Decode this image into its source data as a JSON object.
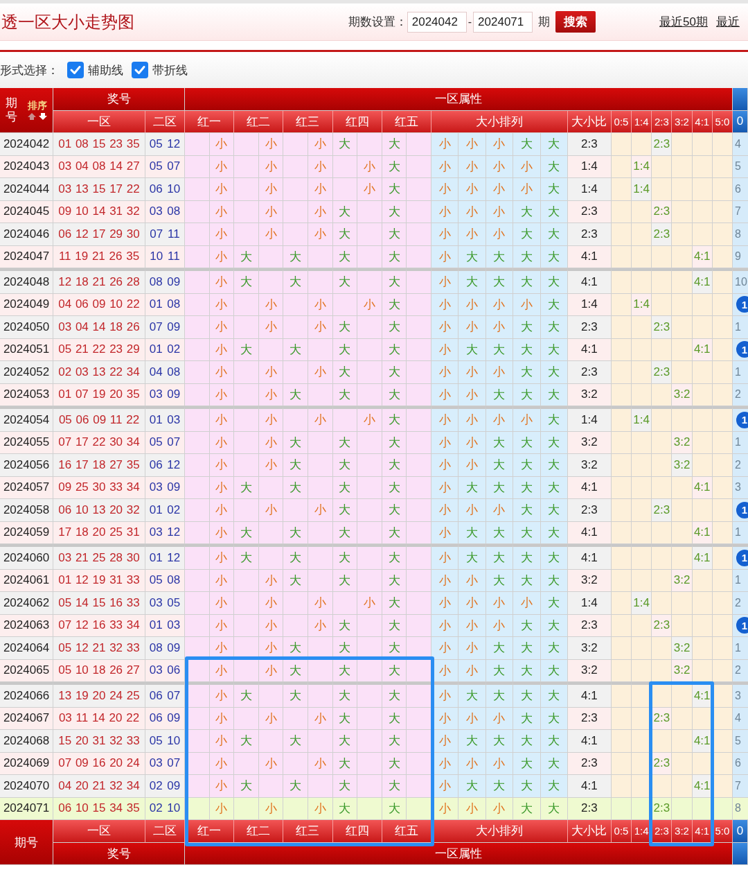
{
  "title": "透一区大小走势图",
  "period_setting": {
    "label": "期数设置：",
    "from": "2024042",
    "separator": "-",
    "to": "2024071",
    "unit": "期",
    "button": "搜索"
  },
  "links": [
    "最近50期",
    "最近"
  ],
  "form": {
    "label": "形式选择：",
    "options": [
      {
        "label": "辅助线",
        "checked": true
      },
      {
        "label": "带折线",
        "checked": true
      }
    ]
  },
  "table_header": {
    "period": "期号",
    "sort": "排序",
    "group_prize": "奖号",
    "group_attr": "一区属性",
    "zone1": "一区",
    "zone2": "二区",
    "positions": [
      "红一",
      "红二",
      "红三",
      "红四",
      "红五"
    ],
    "sequence": "大小排列",
    "ratio": "大小比",
    "distribution": [
      "0:5",
      "1:4",
      "2:3",
      "3:2",
      "4:1",
      "5:0"
    ],
    "extra": "0"
  },
  "rows": [
    {
      "period": "2024042",
      "zone1": "01 08 15 23 35",
      "zone2": "05 12",
      "highlighted": false,
      "positions": [
        {
          "text": "小",
          "big": false
        },
        {
          "text": "小",
          "big": false
        },
        {
          "text": "小",
          "big": false
        },
        {
          "text": "大",
          "big": true
        },
        {
          "text": "大",
          "big": true
        }
      ],
      "sequence": [
        {
          "text": "小",
          "big": false
        },
        {
          "text": "小",
          "big": false
        },
        {
          "text": "小",
          "big": false
        },
        {
          "text": "大",
          "big": true
        },
        {
          "text": "大",
          "big": true
        }
      ],
      "ratio": "2:3",
      "distribution": [
        false,
        false,
        true,
        false,
        false,
        false
      ],
      "ratio_mark": "2:3",
      "extra": {
        "text": "4",
        "circled": false
      }
    },
    {
      "period": "2024043",
      "zone1": "03 04 08 14 27",
      "zone2": "05 07",
      "highlighted": false,
      "positions": [
        {
          "text": "小",
          "big": false
        },
        {
          "text": "小",
          "big": false
        },
        {
          "text": "小",
          "big": false
        },
        {
          "text": "小",
          "big": false
        },
        {
          "text": "大",
          "big": true
        }
      ],
      "sequence": [
        {
          "text": "小",
          "big": false
        },
        {
          "text": "小",
          "big": false
        },
        {
          "text": "小",
          "big": false
        },
        {
          "text": "小",
          "big": false
        },
        {
          "text": "大",
          "big": true
        }
      ],
      "ratio": "1:4",
      "distribution": [
        false,
        true,
        false,
        false,
        false,
        false
      ],
      "ratio_mark": "1:4",
      "extra": {
        "text": "5",
        "circled": false
      }
    },
    {
      "period": "2024044",
      "zone1": "03 13 15 17 22",
      "zone2": "06 10",
      "highlighted": false,
      "positions": [
        {
          "text": "小",
          "big": false
        },
        {
          "text": "小",
          "big": false
        },
        {
          "text": "小",
          "big": false
        },
        {
          "text": "小",
          "big": false
        },
        {
          "text": "大",
          "big": true
        }
      ],
      "sequence": [
        {
          "text": "小",
          "big": false
        },
        {
          "text": "小",
          "big": false
        },
        {
          "text": "小",
          "big": false
        },
        {
          "text": "小",
          "big": false
        },
        {
          "text": "大",
          "big": true
        }
      ],
      "ratio": "1:4",
      "distribution": [
        false,
        true,
        false,
        false,
        false,
        false
      ],
      "ratio_mark": "1:4",
      "extra": {
        "text": "6",
        "circled": false
      }
    },
    {
      "period": "2024045",
      "zone1": "09 10 14 31 32",
      "zone2": "03 08",
      "highlighted": false,
      "positions": [
        {
          "text": "小",
          "big": false
        },
        {
          "text": "小",
          "big": false
        },
        {
          "text": "小",
          "big": false
        },
        {
          "text": "大",
          "big": true
        },
        {
          "text": "大",
          "big": true
        }
      ],
      "sequence": [
        {
          "text": "小",
          "big": false
        },
        {
          "text": "小",
          "big": false
        },
        {
          "text": "小",
          "big": false
        },
        {
          "text": "大",
          "big": true
        },
        {
          "text": "大",
          "big": true
        }
      ],
      "ratio": "2:3",
      "distribution": [
        false,
        false,
        true,
        false,
        false,
        false
      ],
      "ratio_mark": "2:3",
      "extra": {
        "text": "7",
        "circled": false
      }
    },
    {
      "period": "2024046",
      "zone1": "06 12 17 29 30",
      "zone2": "07 11",
      "highlighted": false,
      "positions": [
        {
          "text": "小",
          "big": false
        },
        {
          "text": "小",
          "big": false
        },
        {
          "text": "小",
          "big": false
        },
        {
          "text": "大",
          "big": true
        },
        {
          "text": "大",
          "big": true
        }
      ],
      "sequence": [
        {
          "text": "小",
          "big": false
        },
        {
          "text": "小",
          "big": false
        },
        {
          "text": "小",
          "big": false
        },
        {
          "text": "大",
          "big": true
        },
        {
          "text": "大",
          "big": true
        }
      ],
      "ratio": "2:3",
      "distribution": [
        false,
        false,
        true,
        false,
        false,
        false
      ],
      "ratio_mark": "2:3",
      "extra": {
        "text": "8",
        "circled": false
      }
    },
    {
      "period": "2024047",
      "zone1": "11 19 21 26 35",
      "zone2": "10 11",
      "highlighted": false,
      "positions": [
        {
          "text": "小",
          "big": false
        },
        {
          "text": "大",
          "big": true
        },
        {
          "text": "大",
          "big": true
        },
        {
          "text": "大",
          "big": true
        },
        {
          "text": "大",
          "big": true
        }
      ],
      "sequence": [
        {
          "text": "小",
          "big": false
        },
        {
          "text": "大",
          "big": true
        },
        {
          "text": "大",
          "big": true
        },
        {
          "text": "大",
          "big": true
        },
        {
          "text": "大",
          "big": true
        }
      ],
      "ratio": "4:1",
      "distribution": [
        false,
        false,
        false,
        false,
        true,
        false
      ],
      "ratio_mark": "4:1",
      "extra": {
        "text": "9",
        "circled": false
      }
    },
    {
      "period": "2024048",
      "zone1": "12 18 21 26 28",
      "zone2": "08 09",
      "highlighted": false,
      "positions": [
        {
          "text": "小",
          "big": false
        },
        {
          "text": "大",
          "big": true
        },
        {
          "text": "大",
          "big": true
        },
        {
          "text": "大",
          "big": true
        },
        {
          "text": "大",
          "big": true
        }
      ],
      "sequence": [
        {
          "text": "小",
          "big": false
        },
        {
          "text": "大",
          "big": true
        },
        {
          "text": "大",
          "big": true
        },
        {
          "text": "大",
          "big": true
        },
        {
          "text": "大",
          "big": true
        }
      ],
      "ratio": "4:1",
      "distribution": [
        false,
        false,
        false,
        false,
        true,
        false
      ],
      "ratio_mark": "4:1",
      "extra": {
        "text": "10",
        "circled": false
      }
    },
    {
      "period": "2024049",
      "zone1": "04 06 09 10 22",
      "zone2": "01 08",
      "highlighted": false,
      "positions": [
        {
          "text": "小",
          "big": false
        },
        {
          "text": "小",
          "big": false
        },
        {
          "text": "小",
          "big": false
        },
        {
          "text": "小",
          "big": false
        },
        {
          "text": "大",
          "big": true
        }
      ],
      "sequence": [
        {
          "text": "小",
          "big": false
        },
        {
          "text": "小",
          "big": false
        },
        {
          "text": "小",
          "big": false
        },
        {
          "text": "小",
          "big": false
        },
        {
          "text": "大",
          "big": true
        }
      ],
      "ratio": "1:4",
      "distribution": [
        false,
        true,
        false,
        false,
        false,
        false
      ],
      "ratio_mark": "1:4",
      "extra": {
        "text": "1",
        "circled": true
      }
    },
    {
      "period": "2024050",
      "zone1": "03 04 14 18 26",
      "zone2": "07 09",
      "highlighted": false,
      "positions": [
        {
          "text": "小",
          "big": false
        },
        {
          "text": "小",
          "big": false
        },
        {
          "text": "小",
          "big": false
        },
        {
          "text": "大",
          "big": true
        },
        {
          "text": "大",
          "big": true
        }
      ],
      "sequence": [
        {
          "text": "小",
          "big": false
        },
        {
          "text": "小",
          "big": false
        },
        {
          "text": "小",
          "big": false
        },
        {
          "text": "大",
          "big": true
        },
        {
          "text": "大",
          "big": true
        }
      ],
      "ratio": "2:3",
      "distribution": [
        false,
        false,
        true,
        false,
        false,
        false
      ],
      "ratio_mark": "2:3",
      "extra": {
        "text": "1",
        "circled": false
      }
    },
    {
      "period": "2024051",
      "zone1": "05 21 22 23 29",
      "zone2": "01 02",
      "highlighted": false,
      "positions": [
        {
          "text": "小",
          "big": false
        },
        {
          "text": "大",
          "big": true
        },
        {
          "text": "大",
          "big": true
        },
        {
          "text": "大",
          "big": true
        },
        {
          "text": "大",
          "big": true
        }
      ],
      "sequence": [
        {
          "text": "小",
          "big": false
        },
        {
          "text": "大",
          "big": true
        },
        {
          "text": "大",
          "big": true
        },
        {
          "text": "大",
          "big": true
        },
        {
          "text": "大",
          "big": true
        }
      ],
      "ratio": "4:1",
      "distribution": [
        false,
        false,
        false,
        false,
        true,
        false
      ],
      "ratio_mark": "4:1",
      "extra": {
        "text": "1",
        "circled": true
      }
    },
    {
      "period": "2024052",
      "zone1": "02 03 13 22 34",
      "zone2": "04 08",
      "highlighted": false,
      "positions": [
        {
          "text": "小",
          "big": false
        },
        {
          "text": "小",
          "big": false
        },
        {
          "text": "小",
          "big": false
        },
        {
          "text": "大",
          "big": true
        },
        {
          "text": "大",
          "big": true
        }
      ],
      "sequence": [
        {
          "text": "小",
          "big": false
        },
        {
          "text": "小",
          "big": false
        },
        {
          "text": "小",
          "big": false
        },
        {
          "text": "大",
          "big": true
        },
        {
          "text": "大",
          "big": true
        }
      ],
      "ratio": "2:3",
      "distribution": [
        false,
        false,
        true,
        false,
        false,
        false
      ],
      "ratio_mark": "2:3",
      "extra": {
        "text": "1",
        "circled": false
      }
    },
    {
      "period": "2024053",
      "zone1": "01 07 19 20 35",
      "zone2": "03 09",
      "highlighted": false,
      "positions": [
        {
          "text": "小",
          "big": false
        },
        {
          "text": "小",
          "big": false
        },
        {
          "text": "大",
          "big": true
        },
        {
          "text": "大",
          "big": true
        },
        {
          "text": "大",
          "big": true
        }
      ],
      "sequence": [
        {
          "text": "小",
          "big": false
        },
        {
          "text": "小",
          "big": false
        },
        {
          "text": "大",
          "big": true
        },
        {
          "text": "大",
          "big": true
        },
        {
          "text": "大",
          "big": true
        }
      ],
      "ratio": "3:2",
      "distribution": [
        false,
        false,
        false,
        true,
        false,
        false
      ],
      "ratio_mark": "3:2",
      "extra": {
        "text": "2",
        "circled": false
      }
    },
    {
      "period": "2024054",
      "zone1": "05 06 09 11 22",
      "zone2": "01 03",
      "highlighted": false,
      "positions": [
        {
          "text": "小",
          "big": false
        },
        {
          "text": "小",
          "big": false
        },
        {
          "text": "小",
          "big": false
        },
        {
          "text": "小",
          "big": false
        },
        {
          "text": "大",
          "big": true
        }
      ],
      "sequence": [
        {
          "text": "小",
          "big": false
        },
        {
          "text": "小",
          "big": false
        },
        {
          "text": "小",
          "big": false
        },
        {
          "text": "小",
          "big": false
        },
        {
          "text": "大",
          "big": true
        }
      ],
      "ratio": "1:4",
      "distribution": [
        false,
        true,
        false,
        false,
        false,
        false
      ],
      "ratio_mark": "1:4",
      "extra": {
        "text": "1",
        "circled": true
      }
    },
    {
      "period": "2024055",
      "zone1": "07 17 22 30 34",
      "zone2": "05 07",
      "highlighted": false,
      "positions": [
        {
          "text": "小",
          "big": false
        },
        {
          "text": "小",
          "big": false
        },
        {
          "text": "大",
          "big": true
        },
        {
          "text": "大",
          "big": true
        },
        {
          "text": "大",
          "big": true
        }
      ],
      "sequence": [
        {
          "text": "小",
          "big": false
        },
        {
          "text": "小",
          "big": false
        },
        {
          "text": "大",
          "big": true
        },
        {
          "text": "大",
          "big": true
        },
        {
          "text": "大",
          "big": true
        }
      ],
      "ratio": "3:2",
      "distribution": [
        false,
        false,
        false,
        true,
        false,
        false
      ],
      "ratio_mark": "3:2",
      "extra": {
        "text": "1",
        "circled": false
      }
    },
    {
      "period": "2024056",
      "zone1": "16 17 18 27 35",
      "zone2": "06 12",
      "highlighted": false,
      "positions": [
        {
          "text": "小",
          "big": false
        },
        {
          "text": "小",
          "big": false
        },
        {
          "text": "大",
          "big": true
        },
        {
          "text": "大",
          "big": true
        },
        {
          "text": "大",
          "big": true
        }
      ],
      "sequence": [
        {
          "text": "小",
          "big": false
        },
        {
          "text": "小",
          "big": false
        },
        {
          "text": "大",
          "big": true
        },
        {
          "text": "大",
          "big": true
        },
        {
          "text": "大",
          "big": true
        }
      ],
      "ratio": "3:2",
      "distribution": [
        false,
        false,
        false,
        true,
        false,
        false
      ],
      "ratio_mark": "3:2",
      "extra": {
        "text": "2",
        "circled": false
      }
    },
    {
      "period": "2024057",
      "zone1": "09 25 30 33 34",
      "zone2": "03 09",
      "highlighted": false,
      "positions": [
        {
          "text": "小",
          "big": false
        },
        {
          "text": "大",
          "big": true
        },
        {
          "text": "大",
          "big": true
        },
        {
          "text": "大",
          "big": true
        },
        {
          "text": "大",
          "big": true
        }
      ],
      "sequence": [
        {
          "text": "小",
          "big": false
        },
        {
          "text": "大",
          "big": true
        },
        {
          "text": "大",
          "big": true
        },
        {
          "text": "大",
          "big": true
        },
        {
          "text": "大",
          "big": true
        }
      ],
      "ratio": "4:1",
      "distribution": [
        false,
        false,
        false,
        false,
        true,
        false
      ],
      "ratio_mark": "4:1",
      "extra": {
        "text": "3",
        "circled": false
      }
    },
    {
      "period": "2024058",
      "zone1": "06 10 13 20 32",
      "zone2": "01 02",
      "highlighted": false,
      "positions": [
        {
          "text": "小",
          "big": false
        },
        {
          "text": "小",
          "big": false
        },
        {
          "text": "小",
          "big": false
        },
        {
          "text": "大",
          "big": true
        },
        {
          "text": "大",
          "big": true
        }
      ],
      "sequence": [
        {
          "text": "小",
          "big": false
        },
        {
          "text": "小",
          "big": false
        },
        {
          "text": "小",
          "big": false
        },
        {
          "text": "大",
          "big": true
        },
        {
          "text": "大",
          "big": true
        }
      ],
      "ratio": "2:3",
      "distribution": [
        false,
        false,
        true,
        false,
        false,
        false
      ],
      "ratio_mark": "2:3",
      "extra": {
        "text": "1",
        "circled": true
      }
    },
    {
      "period": "2024059",
      "zone1": "17 18 20 25 31",
      "zone2": "03 12",
      "highlighted": false,
      "positions": [
        {
          "text": "小",
          "big": false
        },
        {
          "text": "大",
          "big": true
        },
        {
          "text": "大",
          "big": true
        },
        {
          "text": "大",
          "big": true
        },
        {
          "text": "大",
          "big": true
        }
      ],
      "sequence": [
        {
          "text": "小",
          "big": false
        },
        {
          "text": "大",
          "big": true
        },
        {
          "text": "大",
          "big": true
        },
        {
          "text": "大",
          "big": true
        },
        {
          "text": "大",
          "big": true
        }
      ],
      "ratio": "4:1",
      "distribution": [
        false,
        false,
        false,
        false,
        true,
        false
      ],
      "ratio_mark": "4:1",
      "extra": {
        "text": "1",
        "circled": false
      }
    },
    {
      "period": "2024060",
      "zone1": "03 21 25 28 30",
      "zone2": "01 12",
      "highlighted": false,
      "positions": [
        {
          "text": "小",
          "big": false
        },
        {
          "text": "大",
          "big": true
        },
        {
          "text": "大",
          "big": true
        },
        {
          "text": "大",
          "big": true
        },
        {
          "text": "大",
          "big": true
        }
      ],
      "sequence": [
        {
          "text": "小",
          "big": false
        },
        {
          "text": "大",
          "big": true
        },
        {
          "text": "大",
          "big": true
        },
        {
          "text": "大",
          "big": true
        },
        {
          "text": "大",
          "big": true
        }
      ],
      "ratio": "4:1",
      "distribution": [
        false,
        false,
        false,
        false,
        true,
        false
      ],
      "ratio_mark": "4:1",
      "extra": {
        "text": "1",
        "circled": true
      }
    },
    {
      "period": "2024061",
      "zone1": "01 12 19 31 33",
      "zone2": "05 08",
      "highlighted": false,
      "positions": [
        {
          "text": "小",
          "big": false
        },
        {
          "text": "小",
          "big": false
        },
        {
          "text": "大",
          "big": true
        },
        {
          "text": "大",
          "big": true
        },
        {
          "text": "大",
          "big": true
        }
      ],
      "sequence": [
        {
          "text": "小",
          "big": false
        },
        {
          "text": "小",
          "big": false
        },
        {
          "text": "大",
          "big": true
        },
        {
          "text": "大",
          "big": true
        },
        {
          "text": "大",
          "big": true
        }
      ],
      "ratio": "3:2",
      "distribution": [
        false,
        false,
        false,
        true,
        false,
        false
      ],
      "ratio_mark": "3:2",
      "extra": {
        "text": "1",
        "circled": false
      }
    },
    {
      "period": "2024062",
      "zone1": "05 14 15 16 33",
      "zone2": "03 05",
      "highlighted": false,
      "positions": [
        {
          "text": "小",
          "big": false
        },
        {
          "text": "小",
          "big": false
        },
        {
          "text": "小",
          "big": false
        },
        {
          "text": "小",
          "big": false
        },
        {
          "text": "大",
          "big": true
        }
      ],
      "sequence": [
        {
          "text": "小",
          "big": false
        },
        {
          "text": "小",
          "big": false
        },
        {
          "text": "小",
          "big": false
        },
        {
          "text": "小",
          "big": false
        },
        {
          "text": "大",
          "big": true
        }
      ],
      "ratio": "1:4",
      "distribution": [
        false,
        true,
        false,
        false,
        false,
        false
      ],
      "ratio_mark": "1:4",
      "extra": {
        "text": "2",
        "circled": false
      }
    },
    {
      "period": "2024063",
      "zone1": "07 12 16 33 34",
      "zone2": "01 03",
      "highlighted": false,
      "positions": [
        {
          "text": "小",
          "big": false
        },
        {
          "text": "小",
          "big": false
        },
        {
          "text": "小",
          "big": false
        },
        {
          "text": "大",
          "big": true
        },
        {
          "text": "大",
          "big": true
        }
      ],
      "sequence": [
        {
          "text": "小",
          "big": false
        },
        {
          "text": "小",
          "big": false
        },
        {
          "text": "小",
          "big": false
        },
        {
          "text": "大",
          "big": true
        },
        {
          "text": "大",
          "big": true
        }
      ],
      "ratio": "2:3",
      "distribution": [
        false,
        false,
        true,
        false,
        false,
        false
      ],
      "ratio_mark": "2:3",
      "extra": {
        "text": "1",
        "circled": true
      }
    },
    {
      "period": "2024064",
      "zone1": "05 12 21 32 33",
      "zone2": "08 09",
      "highlighted": false,
      "positions": [
        {
          "text": "小",
          "big": false
        },
        {
          "text": "小",
          "big": false
        },
        {
          "text": "大",
          "big": true
        },
        {
          "text": "大",
          "big": true
        },
        {
          "text": "大",
          "big": true
        }
      ],
      "sequence": [
        {
          "text": "小",
          "big": false
        },
        {
          "text": "小",
          "big": false
        },
        {
          "text": "大",
          "big": true
        },
        {
          "text": "大",
          "big": true
        },
        {
          "text": "大",
          "big": true
        }
      ],
      "ratio": "3:2",
      "distribution": [
        false,
        false,
        false,
        true,
        false,
        false
      ],
      "ratio_mark": "3:2",
      "extra": {
        "text": "1",
        "circled": false
      }
    },
    {
      "period": "2024065",
      "zone1": "05 10 18 26 27",
      "zone2": "03 06",
      "highlighted": false,
      "positions": [
        {
          "text": "小",
          "big": false
        },
        {
          "text": "小",
          "big": false
        },
        {
          "text": "大",
          "big": true
        },
        {
          "text": "大",
          "big": true
        },
        {
          "text": "大",
          "big": true
        }
      ],
      "sequence": [
        {
          "text": "小",
          "big": false
        },
        {
          "text": "小",
          "big": false
        },
        {
          "text": "大",
          "big": true
        },
        {
          "text": "大",
          "big": true
        },
        {
          "text": "大",
          "big": true
        }
      ],
      "ratio": "3:2",
      "distribution": [
        false,
        false,
        false,
        true,
        false,
        false
      ],
      "ratio_mark": "3:2",
      "extra": {
        "text": "2",
        "circled": false
      }
    },
    {
      "period": "2024066",
      "zone1": "13 19 20 24 25",
      "zone2": "06 07",
      "highlighted": false,
      "positions": [
        {
          "text": "小",
          "big": false
        },
        {
          "text": "大",
          "big": true
        },
        {
          "text": "大",
          "big": true
        },
        {
          "text": "大",
          "big": true
        },
        {
          "text": "大",
          "big": true
        }
      ],
      "sequence": [
        {
          "text": "小",
          "big": false
        },
        {
          "text": "大",
          "big": true
        },
        {
          "text": "大",
          "big": true
        },
        {
          "text": "大",
          "big": true
        },
        {
          "text": "大",
          "big": true
        }
      ],
      "ratio": "4:1",
      "distribution": [
        false,
        false,
        false,
        false,
        true,
        false
      ],
      "ratio_mark": "4:1",
      "extra": {
        "text": "3",
        "circled": false
      }
    },
    {
      "period": "2024067",
      "zone1": "03 11 14 20 22",
      "zone2": "06 09",
      "highlighted": false,
      "positions": [
        {
          "text": "小",
          "big": false
        },
        {
          "text": "小",
          "big": false
        },
        {
          "text": "小",
          "big": false
        },
        {
          "text": "大",
          "big": true
        },
        {
          "text": "大",
          "big": true
        }
      ],
      "sequence": [
        {
          "text": "小",
          "big": false
        },
        {
          "text": "小",
          "big": false
        },
        {
          "text": "小",
          "big": false
        },
        {
          "text": "大",
          "big": true
        },
        {
          "text": "大",
          "big": true
        }
      ],
      "ratio": "2:3",
      "distribution": [
        false,
        false,
        true,
        false,
        false,
        false
      ],
      "ratio_mark": "2:3",
      "extra": {
        "text": "4",
        "circled": false
      }
    },
    {
      "period": "2024068",
      "zone1": "15 20 31 32 33",
      "zone2": "05 10",
      "highlighted": false,
      "positions": [
        {
          "text": "小",
          "big": false
        },
        {
          "text": "大",
          "big": true
        },
        {
          "text": "大",
          "big": true
        },
        {
          "text": "大",
          "big": true
        },
        {
          "text": "大",
          "big": true
        }
      ],
      "sequence": [
        {
          "text": "小",
          "big": false
        },
        {
          "text": "大",
          "big": true
        },
        {
          "text": "大",
          "big": true
        },
        {
          "text": "大",
          "big": true
        },
        {
          "text": "大",
          "big": true
        }
      ],
      "ratio": "4:1",
      "distribution": [
        false,
        false,
        false,
        false,
        true,
        false
      ],
      "ratio_mark": "4:1",
      "extra": {
        "text": "5",
        "circled": false
      }
    },
    {
      "period": "2024069",
      "zone1": "07 09 16 20 24",
      "zone2": "03 07",
      "highlighted": false,
      "positions": [
        {
          "text": "小",
          "big": false
        },
        {
          "text": "小",
          "big": false
        },
        {
          "text": "小",
          "big": false
        },
        {
          "text": "大",
          "big": true
        },
        {
          "text": "大",
          "big": true
        }
      ],
      "sequence": [
        {
          "text": "小",
          "big": false
        },
        {
          "text": "小",
          "big": false
        },
        {
          "text": "小",
          "big": false
        },
        {
          "text": "大",
          "big": true
        },
        {
          "text": "大",
          "big": true
        }
      ],
      "ratio": "2:3",
      "distribution": [
        false,
        false,
        true,
        false,
        false,
        false
      ],
      "ratio_mark": "2:3",
      "extra": {
        "text": "6",
        "circled": false
      }
    },
    {
      "period": "2024070",
      "zone1": "04 20 21 32 34",
      "zone2": "02 09",
      "highlighted": false,
      "positions": [
        {
          "text": "小",
          "big": false
        },
        {
          "text": "大",
          "big": true
        },
        {
          "text": "大",
          "big": true
        },
        {
          "text": "大",
          "big": true
        },
        {
          "text": "大",
          "big": true
        }
      ],
      "sequence": [
        {
          "text": "小",
          "big": false
        },
        {
          "text": "大",
          "big": true
        },
        {
          "text": "大",
          "big": true
        },
        {
          "text": "大",
          "big": true
        },
        {
          "text": "大",
          "big": true
        }
      ],
      "ratio": "4:1",
      "distribution": [
        false,
        false,
        false,
        false,
        true,
        false
      ],
      "ratio_mark": "4:1",
      "extra": {
        "text": "7",
        "circled": false
      }
    },
    {
      "period": "2024071",
      "zone1": "06 10 15 34 35",
      "zone2": "02 10",
      "highlighted": true,
      "positions": [
        {
          "text": "小",
          "big": false
        },
        {
          "text": "小",
          "big": false
        },
        {
          "text": "小",
          "big": false
        },
        {
          "text": "大",
          "big": true
        },
        {
          "text": "大",
          "big": true
        }
      ],
      "sequence": [
        {
          "text": "小",
          "big": false
        },
        {
          "text": "小",
          "big": false
        },
        {
          "text": "小",
          "big": false
        },
        {
          "text": "大",
          "big": true
        },
        {
          "text": "大",
          "big": true
        }
      ],
      "ratio": "2:3",
      "distribution": [
        false,
        false,
        true,
        false,
        false,
        false
      ],
      "ratio_mark": "2:3",
      "extra": {
        "text": "8",
        "circled": false
      }
    }
  ],
  "table_footer": {
    "period": "期号",
    "zone1": "一区",
    "zone2": "二区",
    "positions": [
      "红一",
      "红二",
      "红三",
      "红四",
      "红五"
    ],
    "sequence": "大小排列",
    "ratio": "大小比",
    "distribution": [
      "0:5",
      "1:4",
      "2:3",
      "3:2",
      "4:1",
      "5:0"
    ],
    "extra": "0",
    "group_prize": "奖号",
    "group_attr": "一区属性"
  }
}
